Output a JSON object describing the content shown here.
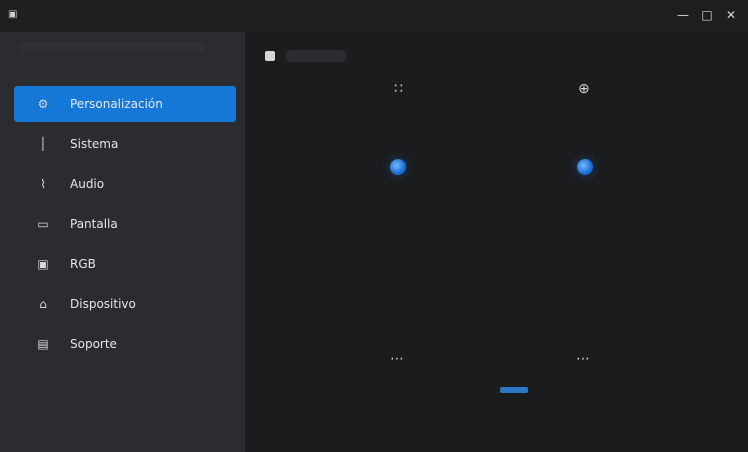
{
  "titlebar": {
    "app_icon": "app-icon",
    "controls": [
      {
        "name": "minimize",
        "label": "—"
      },
      {
        "name": "maximize",
        "label": "□"
      },
      {
        "name": "close",
        "label": "✕"
      }
    ]
  },
  "sidebar": {
    "items": [
      {
        "icon": "gear-icon",
        "label": "Personalización"
      },
      {
        "icon": "bar-icon",
        "label": "Sistema"
      },
      {
        "icon": "bolt-icon",
        "label": "Audio"
      },
      {
        "icon": "display-icon",
        "label": "Pantalla"
      },
      {
        "icon": "rgb-icon",
        "label": "RGB"
      },
      {
        "icon": "device-icon",
        "label": "Dispositivo"
      },
      {
        "icon": "gamepad-icon",
        "label": "Soporte"
      }
    ]
  },
  "main": {
    "header": {
      "title_icon": "home-icon"
    },
    "markers": [
      {
        "text": "∷"
      },
      {
        "text": "⊕"
      },
      {
        "text": "⋯"
      },
      {
        "text": "⋯"
      }
    ]
  }
}
